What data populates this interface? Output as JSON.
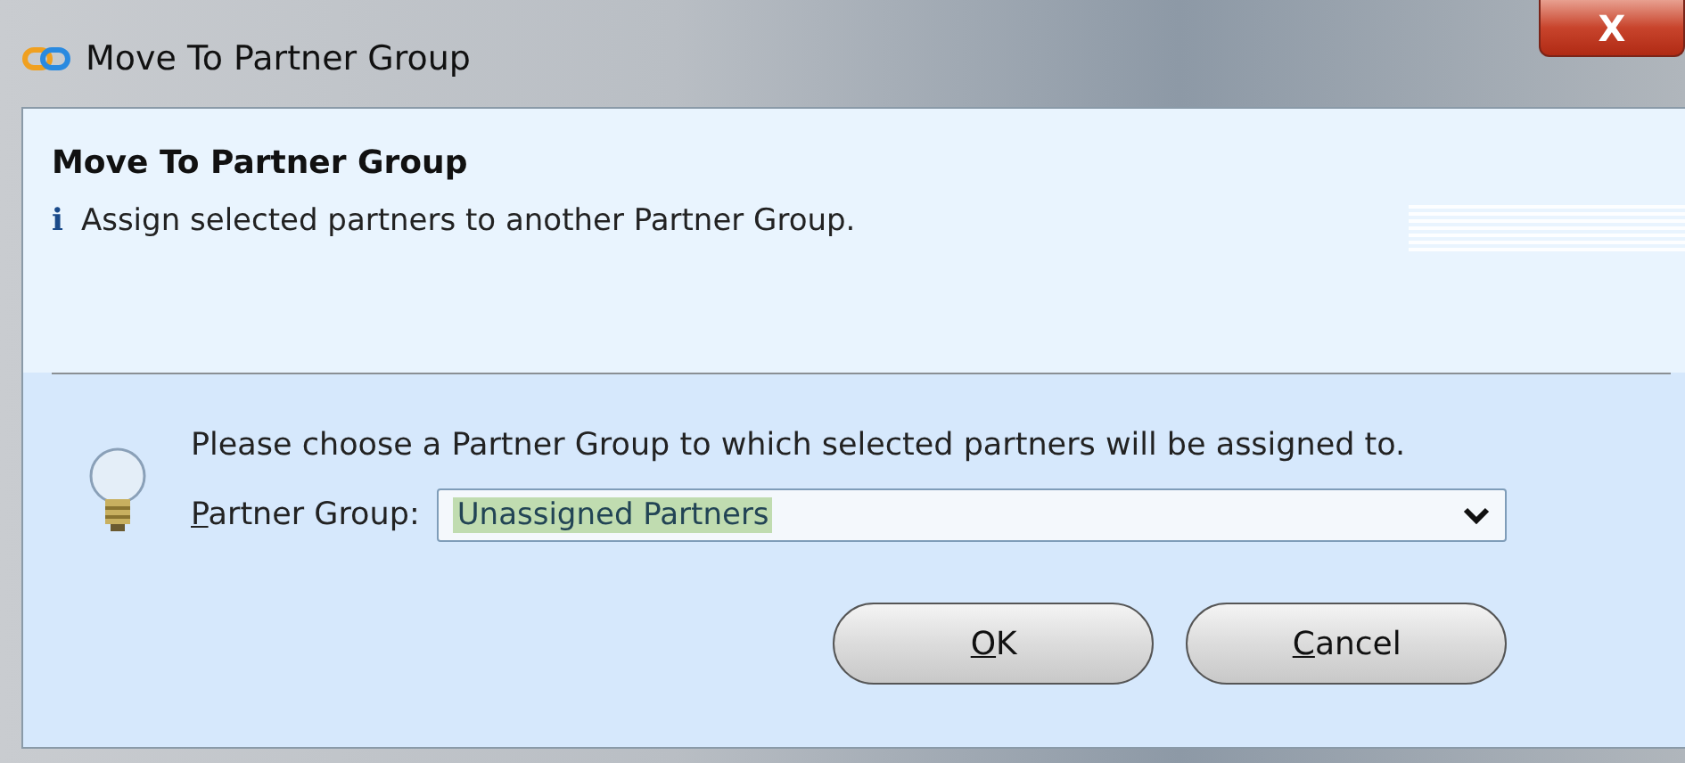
{
  "window": {
    "title": "Move To Partner Group",
    "close": "X"
  },
  "header": {
    "title": "Move To Partner Group",
    "info_icon": "i",
    "description": "Assign selected partners to another Partner Group."
  },
  "prompt": "Please choose a Partner Group to which selected partners will be assigned to.",
  "field": {
    "label_key": "P",
    "label_rest": "artner Group:",
    "value": "Unassigned Partners"
  },
  "buttons": [
    {
      "key": "O",
      "rest": "K"
    },
    {
      "key": "C",
      "rest": "ancel"
    }
  ]
}
